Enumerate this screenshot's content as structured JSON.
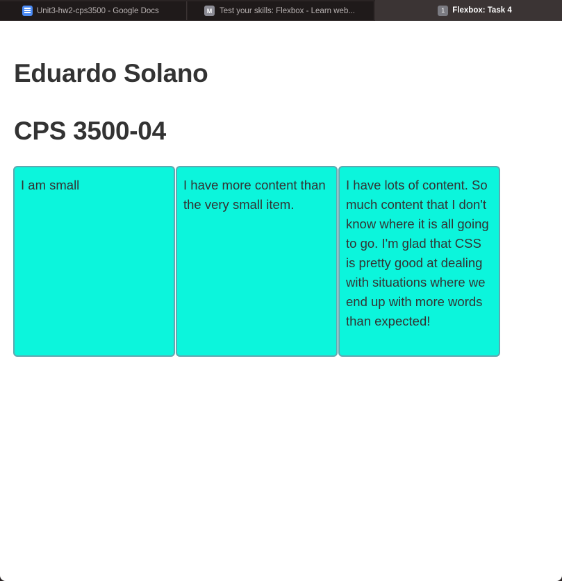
{
  "tabs": [
    {
      "label": "Unit3-hw2-cps3500 - Google Docs",
      "icon": "google-docs-icon"
    },
    {
      "label": "Test your skills: Flexbox - Learn web...",
      "icon": "mdn-icon",
      "icon_text": "M"
    },
    {
      "label": "Flexbox: Task 4",
      "icon": "badge-icon",
      "icon_text": "1",
      "active": true
    }
  ],
  "page": {
    "name": "Eduardo Solano",
    "course": "CPS 3500-04"
  },
  "boxes": [
    {
      "text": "I am small"
    },
    {
      "text": "I have more content than the very small item."
    },
    {
      "text": "I have lots of content. So much content that I don't know where it is all going to go. I'm glad that CSS is pretty good at dealing with situations where we end up with more words than expected!"
    }
  ],
  "colors": {
    "box_bg": "#0cf5dc",
    "text": "#333333",
    "tab_bar": "#2a2424"
  }
}
